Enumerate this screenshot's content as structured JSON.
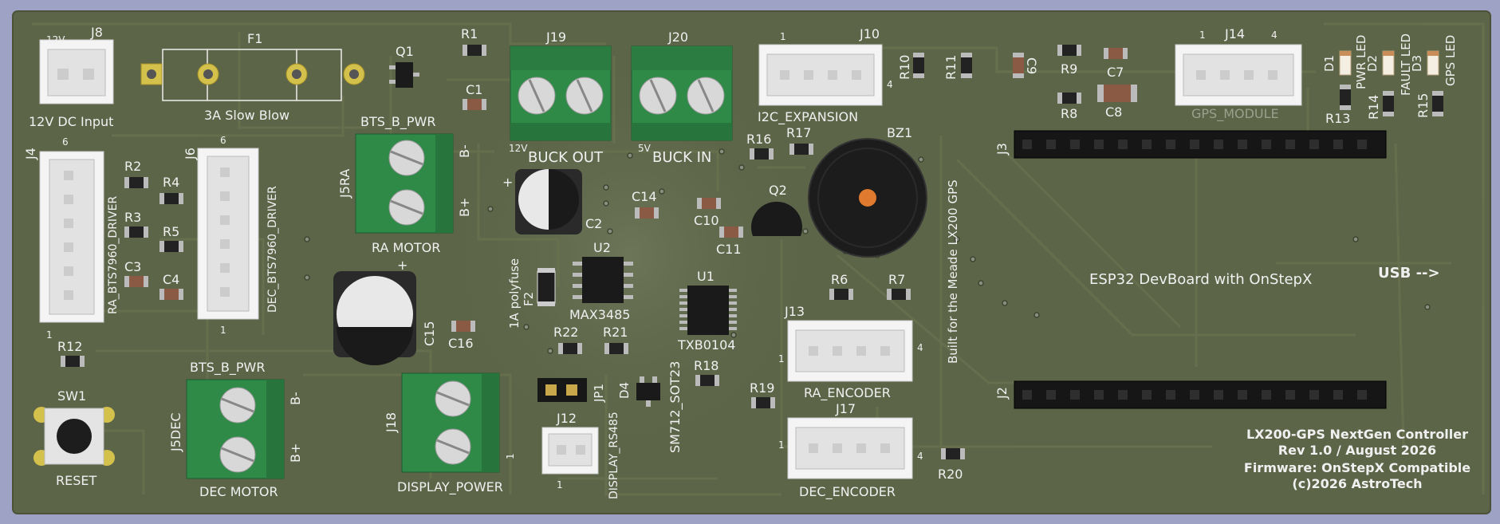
{
  "board": {
    "substrate_color": "#5d6549",
    "background_color": "#9ea3c6",
    "silkscreen_color": "#f0f0f0"
  },
  "labels": {
    "r1": "R1",
    "r2": "R2",
    "r3": "R3",
    "r4": "R4",
    "r5": "R5",
    "r6": "R6",
    "r7": "R7",
    "r8": "R8",
    "r9": "R9",
    "r10": "R10",
    "r11": "R11",
    "r12": "R12",
    "r13": "R13",
    "r14": "R14",
    "r15": "R15",
    "r16": "R16",
    "r17": "R17",
    "r18": "R18",
    "r19": "R19",
    "r20": "R20",
    "r21": "R21",
    "r22": "R22",
    "c1": "C1",
    "c2": "C2",
    "c3": "C3",
    "c4": "C4",
    "c7": "C7",
    "c8": "C8",
    "c9": "C9",
    "c10": "C10",
    "c11": "C11",
    "c14": "C14",
    "c15": "C15",
    "c16": "C16",
    "u1": "U1",
    "u2": "U2",
    "q1": "Q1",
    "q2": "Q2",
    "bz1": "BZ1",
    "f1": "F1",
    "f2": "F2",
    "d1": "D1",
    "d2": "D2",
    "d3": "D3",
    "d4": "D4",
    "sw1": "SW1",
    "jp1": "JP1",
    "j2": "J2",
    "j3": "J3",
    "j4": "J4",
    "j6": "J6",
    "j8": "J8",
    "j10": "J10",
    "j12": "J12",
    "j13": "J13",
    "j14": "J14",
    "j17": "J17",
    "j18": "J18",
    "j19": "J19",
    "j20": "J20",
    "j5ra": "J5RA",
    "j5dec": "J5DEC",
    "v12": "12V",
    "v12b": "12V",
    "v5": "5V",
    "pin1": "1",
    "pin4": "4",
    "pin6": "6",
    "dc_input": "12V DC Input",
    "slow_blow": "3A Slow Blow",
    "bts_pwr_ra": "BTS_B_PWR",
    "bts_pwr_dec": "BTS_B_PWR",
    "ra_motor": "RA MOTOR",
    "dec_motor": "DEC MOTOR",
    "b_minus": "B-",
    "b_plus": "B+",
    "buck_out": "BUCK OUT",
    "buck_in": "BUCK IN",
    "ra_driver": "RA_BTS7960_DRIVER",
    "dec_driver": "DEC_BTS7960_DRIVER",
    "polyfuse": "1A polyfuse",
    "max3485": "MAX3485",
    "txb0104": "TXB0104",
    "sm712": "SM712_SOT23",
    "display_rs485": "DISPLAY_RS485",
    "display_power": "DISPLAY_POWER",
    "i2c_expansion": "I2C_EXPANSION",
    "gps_module": "GPS_MODULE",
    "pwr_led": "PWR LED",
    "fault_led": "FAULT LED",
    "gps_led": "GPS LED",
    "built_for": "Built for the Meade LX200 GPS",
    "esp32": "ESP32 DevBoard with OnStepX",
    "usb": "USB -->",
    "ra_encoder": "RA_ENCODER",
    "dec_encoder": "DEC_ENCODER",
    "reset": "RESET",
    "title1": "LX200-GPS NextGen Controller",
    "title2": "Rev 1.0 / August 2026",
    "title3": "Firmware: OnStepX Compatible",
    "title4": "(c)2026 AstroTech"
  }
}
